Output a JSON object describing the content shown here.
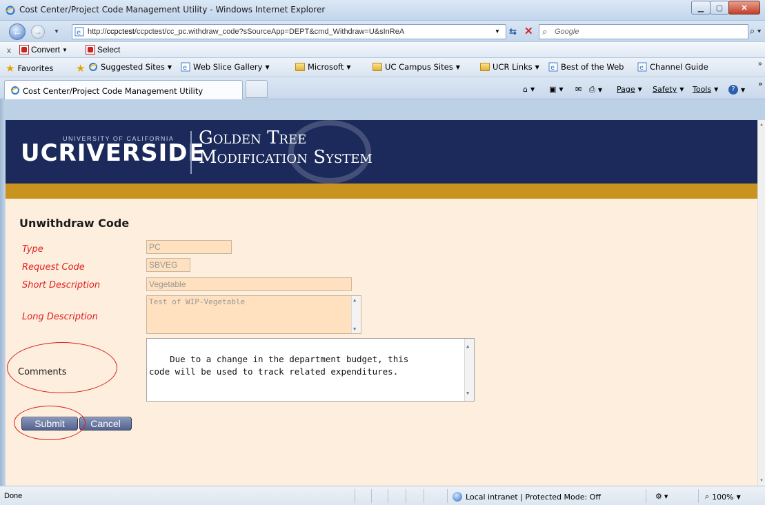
{
  "window": {
    "title": "Cost Center/Project Code Management Utility - Windows Internet Explorer"
  },
  "address": {
    "url_prefix": "http://",
    "url_host": "ccpctest",
    "url_rest": "/ccpctest/cc_pc.withdraw_code?sSourceApp=DEPT&cmd_Withdraw=U&sInReA",
    "search_placeholder": "Google"
  },
  "command_bar": {
    "convert_label": "Convert",
    "select_label": "Select"
  },
  "favorites_bar": {
    "favorites_label": "Favorites",
    "items": [
      {
        "label": "Suggested Sites"
      },
      {
        "label": "Web Slice Gallery"
      },
      {
        "label": "Microsoft"
      },
      {
        "label": "UC Campus Sites"
      },
      {
        "label": "UCR Links"
      },
      {
        "label": "Best of the Web"
      },
      {
        "label": "Channel Guide"
      }
    ]
  },
  "tabs": {
    "active_title": "Cost Center/Project Code Management Utility"
  },
  "toolbar": {
    "page_label": "Page",
    "safety_label": "Safety",
    "tools_label": "Tools"
  },
  "banner": {
    "uc_text": "UCRIVERSIDE",
    "university_text": "UNIVERSITY OF CALIFORNIA",
    "system_line1": "Golden Tree",
    "system_line2": "Modification System"
  },
  "form": {
    "title": "Unwithdraw Code",
    "type_label": "Type",
    "type_value": "PC",
    "request_code_label": "Request Code",
    "request_code_value": "SBVEG",
    "short_desc_label": "Short Description",
    "short_desc_value": "Vegetable",
    "long_desc_label": "Long Description",
    "long_desc_value": "Test of WIP-Vegetable",
    "comments_label": "Comments",
    "comments_value": "Due to a change in the department budget, this\ncode will be used to track related expenditures.",
    "submit_label": "Submit",
    "cancel_label": "Cancel"
  },
  "status": {
    "text": "Done",
    "zone": "Local intranet | Protected Mode: Off",
    "zoom": "100%"
  }
}
